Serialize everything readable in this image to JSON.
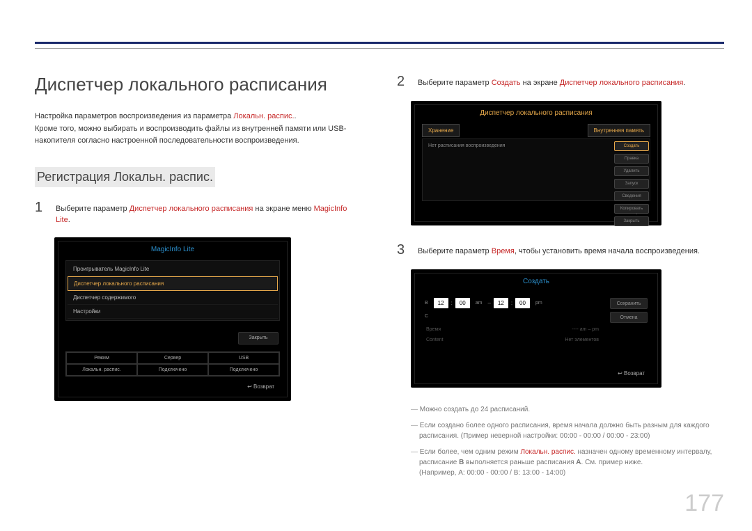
{
  "heading": "Диспетчер локального расписания",
  "desc_pre": "Настройка параметров воспроизведения из параметра ",
  "desc_red": "Локальн. распис.",
  "desc_post": ".",
  "desc_line2": "Кроме того, можно выбирать и воспроизводить файлы из внутренней памяти или USB-накопителя согласно настроенной последовательности воспроизведения.",
  "section": "Регистрация Локальн. распис.",
  "step1": {
    "n": "1",
    "pre": "Выберите параметр ",
    "red1": "Диспетчер локального расписания",
    "mid": " на экране меню ",
    "red2": "MagicInfo Lite",
    "post": "."
  },
  "ui1": {
    "title": "MagicInfo Lite",
    "items": [
      "Проигрыватель MagicInfo Lite",
      "Диспетчер локального расписания",
      "Диспетчер содержимого",
      "Настройки"
    ],
    "close": "Закрыть",
    "grid": [
      "Режим",
      "Сервер",
      "USB",
      "Локальн. распис.",
      "Подключено",
      "Подключено"
    ],
    "ret": "Возврат"
  },
  "step2": {
    "n": "2",
    "pre": "Выберите параметр ",
    "red1": "Создать",
    "mid": " на экране ",
    "red2": "Диспетчер локального расписания",
    "post": "."
  },
  "ui2": {
    "title": "Диспетчер локального расписания",
    "tab1": "Хранение",
    "tab2": "Внутренняя память",
    "msg": "Нет расписания воспроизведения",
    "btns": [
      "Создать",
      "Правка",
      "Удалить",
      "Запуск",
      "Сведения",
      "Копировать",
      "Закрыть"
    ],
    "ret": "Возврат"
  },
  "step3": {
    "n": "3",
    "pre": "Выберите параметр ",
    "red1": "Время",
    "post": ", чтобы установить время начала воспроизведения."
  },
  "ui3": {
    "title": "Создать",
    "leftlabel": "В",
    "leftlabel2": "С",
    "t1": "12",
    "c1": ":",
    "t2": "00",
    "am": "am",
    "dash": "–",
    "t3": "12",
    "c2": ":",
    "t4": "00",
    "pm": "pm",
    "fadeL1a": "Время",
    "fadeL1b": "---- am – pm",
    "fadeL2a": "Content",
    "fadeL2b": "Нет элементов",
    "btnSave": "Сохранить",
    "btnCancel": "Отмена",
    "ret": "Возврат"
  },
  "notes": {
    "n1": "Можно создать до 24 расписаний.",
    "n2": "Если создано более одного расписания, время начала должно быть разным для каждого расписания. (Пример неверной настройки: 00:00 - 00:00 / 00:00 - 23:00)",
    "n3_pre": "Если более, чем одним режим ",
    "n3_red": "Локальн. распис.",
    "n3_post": " назначен одному временному интервалу, расписание ",
    "n3_b1": "B",
    "n3_mid": " выполняется раньше расписания ",
    "n3_b2": "A",
    "n3_end": ". См. пример ниже.",
    "n3_ex": "(Например, A: 00:00 - 00:00 / B: 13:00 - 14:00)"
  },
  "pagenum": "177"
}
